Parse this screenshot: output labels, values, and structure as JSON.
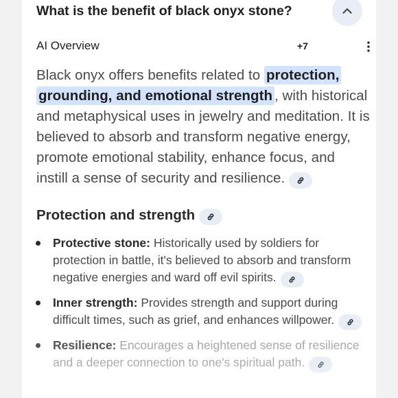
{
  "question": "What is the benefit of black onyx stone?",
  "overview": {
    "label": "AI Overview",
    "source_count": "+7"
  },
  "summary": {
    "lead": "Black onyx offers benefits related to ",
    "highlight": "protection, grounding, and emotional strength",
    "rest": ", with historical and metaphysical uses in jewelry and meditation. It is believed to absorb and transform negative energy, promote emotional stability, enhance focus, and instill a sense of security and resilience."
  },
  "section": {
    "heading": "Protection and strength",
    "bullets": [
      {
        "term": "Protective stone:",
        "text": " Historically used by soldiers for protection in battle, it's believed to absorb and transform negative energies and ward off evil spirits."
      },
      {
        "term": "Inner strength:",
        "text": " Provides strength and support during difficult times, such as grief, and enhances willpower."
      },
      {
        "term": "Resilience:",
        "text": " Encourages a heightened sense of resilience and a deeper connection to one's spiritual path."
      }
    ]
  },
  "icons": {
    "collapse": "chevron-up-icon",
    "more": "more-vert-icon",
    "link": "link-icon"
  },
  "colors": {
    "highlight": "#d3e3fd",
    "chip": "#e9eef6",
    "page_background": "#f2f2f2",
    "card_background": "#ffffff"
  }
}
